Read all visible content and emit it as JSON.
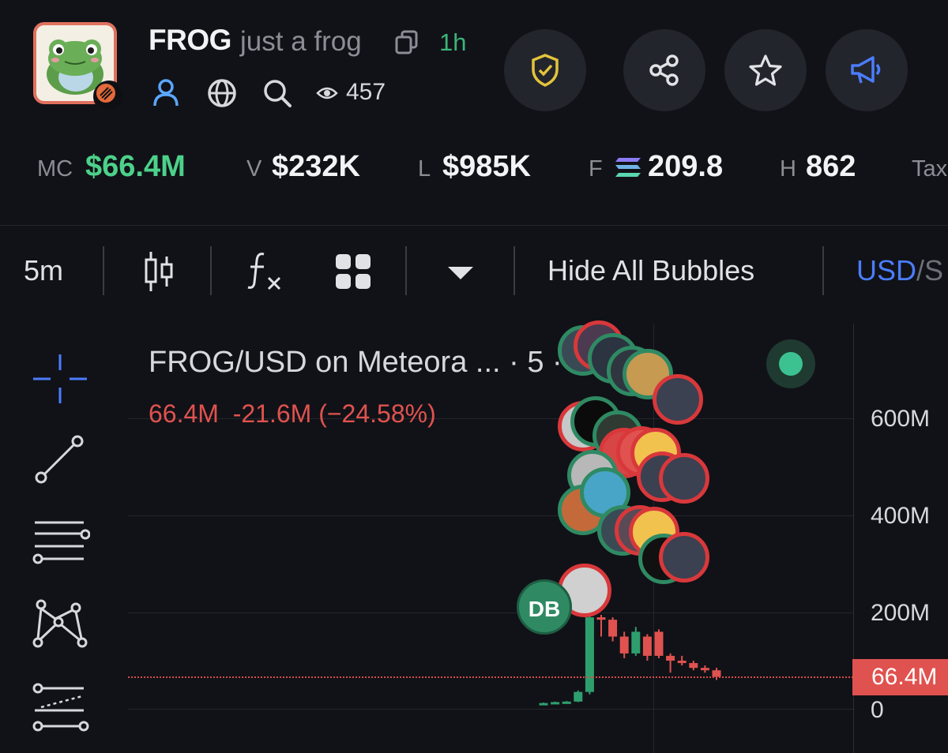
{
  "token": {
    "ticker": "FROG",
    "name": "just a frog",
    "age": "1h",
    "views": "457"
  },
  "actions": [
    "shield-check",
    "share",
    "favorite",
    "announce"
  ],
  "stats": [
    {
      "label": "MC",
      "value": "$66.4M",
      "color": "#4cd18a"
    },
    {
      "label": "V",
      "value": "$232K"
    },
    {
      "label": "L",
      "value": "$985K"
    },
    {
      "label": "F",
      "value": "209.8"
    },
    {
      "label": "H",
      "value": "862"
    },
    {
      "label": "Tax",
      "value": ""
    }
  ],
  "toolbar": {
    "interval": "5m",
    "hide_bubbles": "Hide All Bubbles",
    "currency_active": "USD",
    "currency_sep": "/",
    "currency_other": "S"
  },
  "chart": {
    "title": "FROG/USD on Meteora ... · 5 · axi...",
    "legend_value": "66.4M",
    "legend_change": "-21.6M (−24.58%)",
    "y_ticks": [
      "600M",
      "400M",
      "200M",
      "0"
    ],
    "current_price": "66.4M",
    "bubble_initials": "DB"
  },
  "chart_data": {
    "type": "candlestick",
    "title": "FROG/USD on Meteora",
    "y_unit": "market cap (USD)",
    "ylim": [
      0,
      700000000
    ],
    "current": 66400000,
    "candles": [
      {
        "o": 10000000,
        "c": 12000000,
        "h": 13000000,
        "l": 9000000
      },
      {
        "o": 12000000,
        "c": 14000000,
        "h": 15000000,
        "l": 11000000
      },
      {
        "o": 14000000,
        "c": 15000000,
        "h": 16000000,
        "l": 13000000
      },
      {
        "o": 15000000,
        "c": 35000000,
        "h": 38000000,
        "l": 14000000
      },
      {
        "o": 35000000,
        "c": 190000000,
        "h": 200000000,
        "l": 30000000
      },
      {
        "o": 190000000,
        "c": 185000000,
        "h": 195000000,
        "l": 150000000
      },
      {
        "o": 185000000,
        "c": 150000000,
        "h": 190000000,
        "l": 140000000
      },
      {
        "o": 150000000,
        "c": 115000000,
        "h": 160000000,
        "l": 105000000
      },
      {
        "o": 115000000,
        "c": 160000000,
        "h": 170000000,
        "l": 110000000
      },
      {
        "o": 150000000,
        "c": 110000000,
        "h": 155000000,
        "l": 100000000
      },
      {
        "o": 160000000,
        "c": 110000000,
        "h": 165000000,
        "l": 105000000
      },
      {
        "o": 110000000,
        "c": 100000000,
        "h": 115000000,
        "l": 75000000
      },
      {
        "o": 100000000,
        "c": 95000000,
        "h": 110000000,
        "l": 90000000
      },
      {
        "o": 95000000,
        "c": 85000000,
        "h": 100000000,
        "l": 80000000
      },
      {
        "o": 85000000,
        "c": 80000000,
        "h": 90000000,
        "l": 75000000
      },
      {
        "o": 80000000,
        "c": 66400000,
        "h": 85000000,
        "l": 60000000
      }
    ]
  }
}
